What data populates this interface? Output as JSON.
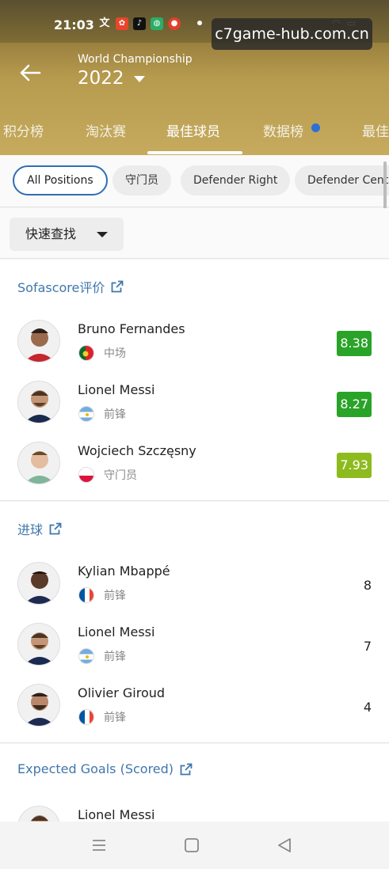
{
  "status": {
    "time": "21:03",
    "watermark": "c7game-hub.com.cn"
  },
  "header": {
    "competition": "World Championship",
    "season": "2022"
  },
  "tabs": [
    {
      "label": "积分榜"
    },
    {
      "label": "淘汰赛"
    },
    {
      "label": "最佳球员",
      "active": true
    },
    {
      "label": "数据榜",
      "has_dot": true
    },
    {
      "label": "最佳"
    }
  ],
  "filters": {
    "chips": [
      {
        "label": "All Positions",
        "active": true
      },
      {
        "label": "守门员"
      },
      {
        "label": "Defender Right"
      },
      {
        "label": "Defender Cente"
      }
    ],
    "quick_find": "快速查找"
  },
  "sections": [
    {
      "title": "Sofascore评价",
      "players": [
        {
          "name": "Bruno Fernandes",
          "position": "中场",
          "value": "8.38",
          "country": "portugal",
          "rating_color": "#2aa329"
        },
        {
          "name": "Lionel Messi",
          "position": "前锋",
          "value": "8.27",
          "country": "argentina",
          "rating_color": "#2aa329"
        },
        {
          "name": "Wojciech Szczęsny",
          "position": "守门员",
          "value": "7.93",
          "country": "poland",
          "rating_color": "#8dbb1e"
        }
      ]
    },
    {
      "title": "进球",
      "players": [
        {
          "name": "Kylian Mbappé",
          "position": "前锋",
          "value": "8",
          "country": "france"
        },
        {
          "name": "Lionel Messi",
          "position": "前锋",
          "value": "7",
          "country": "argentina"
        },
        {
          "name": "Olivier Giroud",
          "position": "前锋",
          "value": "4",
          "country": "france"
        }
      ]
    },
    {
      "title": "Expected Goals (Scored)",
      "players": [
        {
          "name": "Lionel Messi"
        }
      ]
    }
  ]
}
